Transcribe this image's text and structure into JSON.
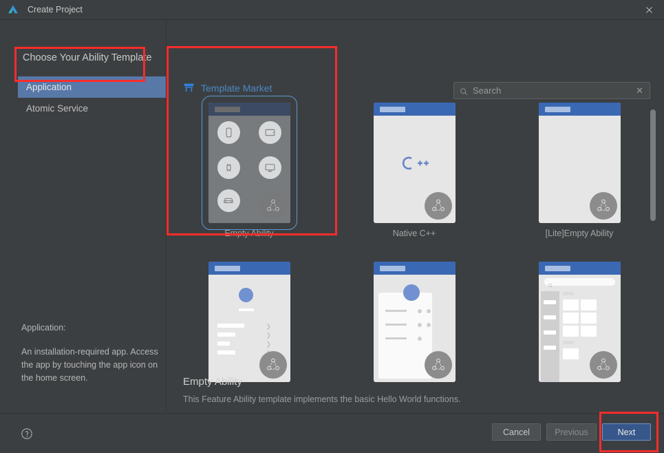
{
  "window": {
    "title": "Create Project",
    "logo_icon": "deveco-logo-icon",
    "close_icon": "close-icon"
  },
  "left_pane": {
    "section_title": "Choose Your Ability Template",
    "items": [
      {
        "label": "Application",
        "selected": true
      },
      {
        "label": "Atomic Service",
        "selected": false
      }
    ],
    "description_label": "Application:",
    "description_text": "An installation-required app. Access the app by touching the app icon on the home screen."
  },
  "market": {
    "icon": "storefront-icon",
    "label": "Template Market"
  },
  "search": {
    "icon": "search-icon",
    "placeholder": "Search",
    "value": "",
    "clear_icon": "clear-x-icon"
  },
  "templates": [
    {
      "label": "Empty Ability",
      "kind": "devices",
      "selected": true
    },
    {
      "label": "Native C++",
      "kind": "cpp",
      "selected": false
    },
    {
      "label": "[Lite]Empty Ability",
      "kind": "blank",
      "selected": false
    },
    {
      "label": "",
      "kind": "list",
      "selected": false
    },
    {
      "label": "",
      "kind": "card",
      "selected": false
    },
    {
      "label": "",
      "kind": "catalog",
      "selected": false
    }
  ],
  "selection": {
    "name": "Empty Ability",
    "description": "This Feature Ability template implements the basic Hello World functions."
  },
  "footer": {
    "help_icon": "help-circle-icon",
    "cancel_label": "Cancel",
    "previous_label": "Previous",
    "next_label": "Next"
  },
  "colors": {
    "background": "#3c3f41",
    "accent_blue": "#4a88c7",
    "selection_blue": "#5878a8",
    "primary_button": "#37568a",
    "annotation_red": "#fb2c2c",
    "thumb_header_blue": "#3a68b3"
  }
}
